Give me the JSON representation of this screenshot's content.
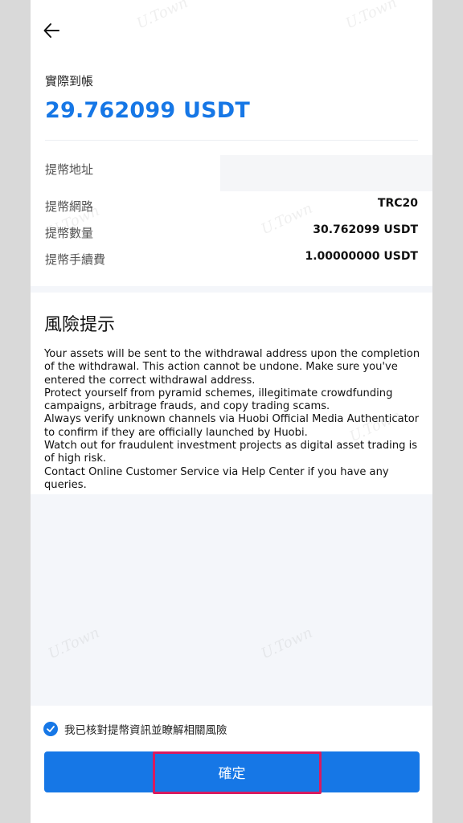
{
  "header": {
    "back_icon": "arrow-left-icon"
  },
  "summary": {
    "amount_label": "實際到帳",
    "amount_value": "29.762099 USDT",
    "address_label": "提幣地址",
    "rows": [
      {
        "label": "提幣網路",
        "value": "TRC20"
      },
      {
        "label": "提幣數量",
        "value": "30.762099 USDT"
      },
      {
        "label": "提幣手續費",
        "value": "1.00000000 USDT"
      }
    ]
  },
  "risk": {
    "title": "風險提示",
    "paragraphs": [
      "Your assets will be sent to the withdrawal address upon the completion of the withdrawal. This action cannot be undone. Make sure you've entered the correct withdrawal address.",
      "Protect yourself from pyramid schemes, illegitimate crowdfunding campaigns, arbitrage frauds, and copy trading scams.",
      "Always verify unknown channels via Huobi Official Media Authenticator to confirm if they are officially launched by Huobi.",
      "Watch out for fraudulent investment projects as digital asset trading is of high risk.",
      "Contact Online Customer Service via Help Center if you have any queries."
    ]
  },
  "footer": {
    "checkbox_label": "我已核對提幣資訊並瞭解相關風險",
    "checkbox_checked": true,
    "confirm_label": "確定"
  },
  "watermark_text": "U.Town",
  "colors": {
    "accent": "#1677e6",
    "highlight": "#d81b60"
  }
}
